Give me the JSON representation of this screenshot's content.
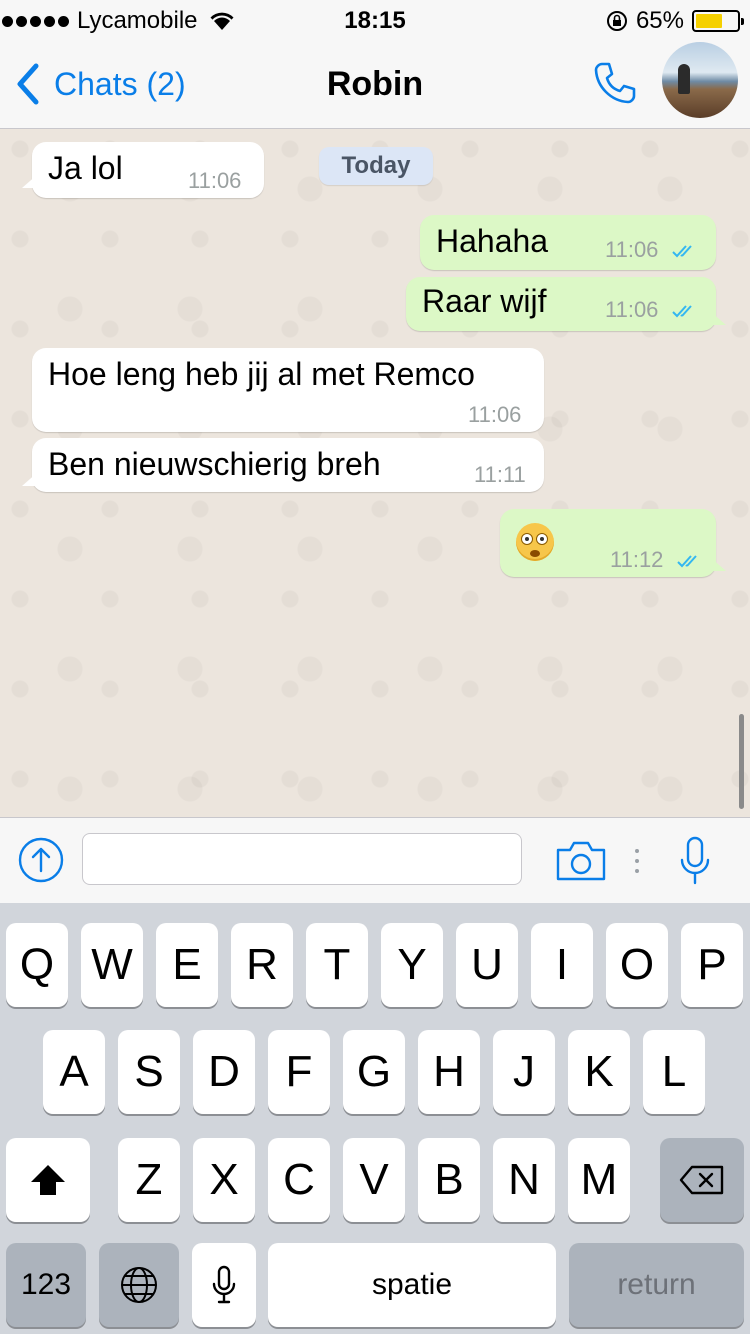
{
  "status_bar": {
    "carrier": "Lycamobile",
    "time": "18:15",
    "battery_percent": "65%",
    "battery_level": 0.65,
    "battery_color": "#f5d000"
  },
  "nav": {
    "back_label": "Chats (2)",
    "title": "Robin",
    "accent_color": "#0a7ee8",
    "icons": [
      "chevron-left-icon",
      "phone-icon",
      "avatar"
    ]
  },
  "chat": {
    "date_separator": "Today",
    "messages": [
      {
        "direction": "in",
        "text": "Ja lol",
        "time": "11:06"
      },
      {
        "direction": "out",
        "text": "Hahaha",
        "time": "11:06",
        "status": "read"
      },
      {
        "direction": "out",
        "text": "Raar wijf",
        "time": "11:06",
        "status": "read"
      },
      {
        "direction": "in",
        "text": "Hoe leng heb jij al met Remco",
        "time": "11:06"
      },
      {
        "direction": "in",
        "text": "Ben nieuwschierig breh",
        "time": "11:11"
      },
      {
        "direction": "out",
        "text": "😳",
        "time": "11:12",
        "status": "read",
        "emoji_icon": "flushed-face-emoji"
      }
    ],
    "outgoing_color": "#dcf8c6",
    "incoming_color": "#ffffff",
    "read_tick_color": "#34b7f1"
  },
  "input_bar": {
    "message_value": "",
    "icons": [
      "upload-icon",
      "camera-icon",
      "more-dots-icon",
      "microphone-icon"
    ]
  },
  "keyboard": {
    "row1": [
      "Q",
      "W",
      "E",
      "R",
      "T",
      "Y",
      "U",
      "I",
      "O",
      "P"
    ],
    "row2": [
      "A",
      "S",
      "D",
      "F",
      "G",
      "H",
      "J",
      "K",
      "L"
    ],
    "row3": [
      "Z",
      "X",
      "C",
      "V",
      "B",
      "N",
      "M"
    ],
    "numbers_key": "123",
    "space_key": "spatie",
    "return_key": "return",
    "icons": [
      "shift-icon",
      "backspace-icon",
      "globe-icon",
      "dictation-icon"
    ]
  }
}
